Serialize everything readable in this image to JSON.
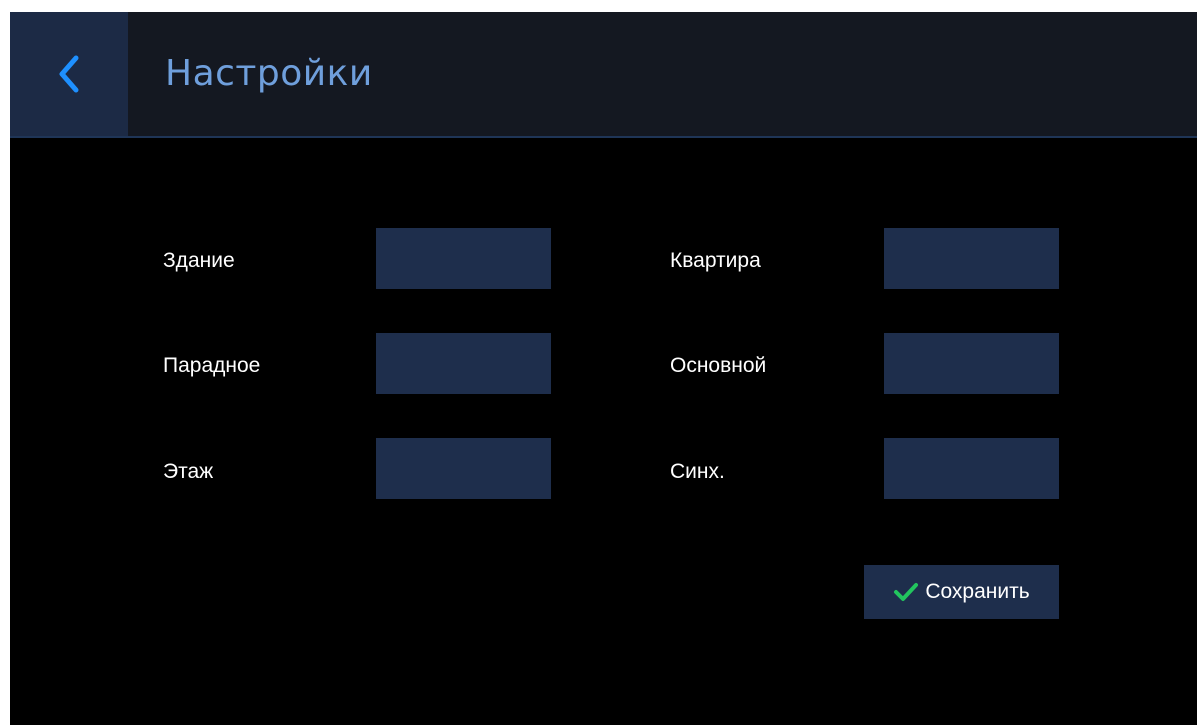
{
  "header": {
    "title": "Настройки",
    "back_icon": "chevron-left-icon"
  },
  "form": {
    "left": [
      {
        "label": "Здание",
        "value": ""
      },
      {
        "label": "Парадное",
        "value": ""
      },
      {
        "label": "Этаж",
        "value": ""
      }
    ],
    "right": [
      {
        "label": "Квартира",
        "value": ""
      },
      {
        "label": "Основной",
        "value": ""
      },
      {
        "label": "Синх.",
        "value": ""
      }
    ]
  },
  "save": {
    "label": "Сохранить",
    "icon": "checkmark-icon"
  },
  "colors": {
    "accent": "#1e90ff",
    "header_bg": "#141821",
    "field_bg": "#1e2e4c",
    "title_text": "#6f9fdc",
    "check_green": "#22c55e"
  }
}
